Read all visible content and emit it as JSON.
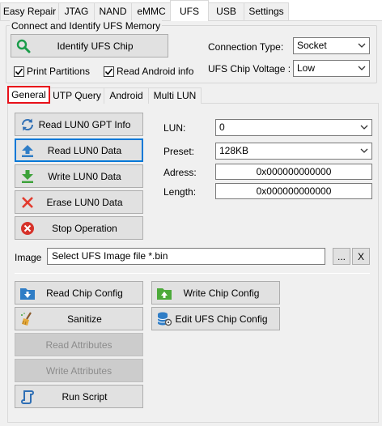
{
  "top_tabs": [
    "Easy Repair",
    "JTAG",
    "NAND",
    "eMMC",
    "UFS",
    "USB",
    "Settings"
  ],
  "active_top_tab": "UFS",
  "identify_group": {
    "title": "Connect and Identify UFS Memory",
    "identify_button": "Identify UFS Chip",
    "print_partitions": {
      "label": "Print Partitions",
      "checked": true
    },
    "read_android_info": {
      "label": "Read Android info",
      "checked": true
    },
    "connection_type": {
      "label": "Connection Type:",
      "value": "Socket"
    },
    "chip_voltage": {
      "label": "UFS Chip Voltage :",
      "value": "Low"
    }
  },
  "sub_tabs": [
    "General",
    "UTP Query",
    "Android",
    "Multi LUN"
  ],
  "active_sub_tab": "General",
  "general": {
    "buttons": {
      "read_gpt": "Read LUN0 GPT Info",
      "read_data": "Read LUN0 Data",
      "write_data": "Write LUN0 Data",
      "erase_data": "Erase LUN0 Data",
      "stop": "Stop Operation"
    },
    "lun": {
      "label": "LUN:",
      "value": "0"
    },
    "preset": {
      "label": "Preset:",
      "value": "128KB"
    },
    "address": {
      "label": "Adress:",
      "value": "0x000000000000"
    },
    "length": {
      "label": "Length:",
      "value": "0x000000000000"
    },
    "image": {
      "label": "Image",
      "value": "Select UFS Image file *.bin",
      "browse": "...",
      "clear": "X"
    },
    "bottom_buttons": {
      "read_chip_config": "Read Chip Config",
      "write_chip_config": "Write Chip Config",
      "sanitize": "Sanitize",
      "edit_chip_config": "Edit UFS Chip Config",
      "read_attributes": "Read Attributes",
      "write_attributes": "Write Attributes",
      "run_script": "Run Script"
    }
  },
  "colors": {
    "accent": "#0078d7",
    "highlight_red": "#e8111a",
    "panel_bg": "#f0f0f0"
  }
}
